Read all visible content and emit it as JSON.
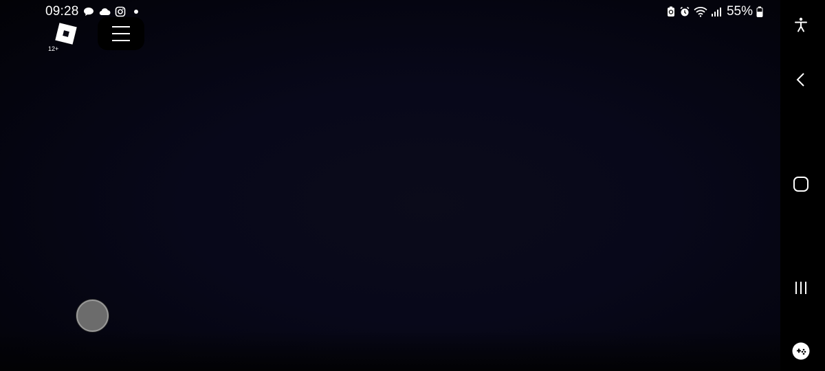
{
  "status_bar": {
    "time": "09:28",
    "battery_percent": "55%",
    "left_icons": [
      "chat-bubble-icon",
      "cloud-icon",
      "instagram-icon",
      "notification-dot-icon"
    ],
    "right_icons": [
      "battery-saver-icon",
      "alarm-icon",
      "wifi-icon",
      "signal-icon",
      "battery-icon"
    ]
  },
  "game_overlay": {
    "logo_icon": "roblox-logo-icon",
    "age_rating": "12+",
    "menu_icon": "hamburger-menu-icon",
    "joystick_icon": "virtual-joystick"
  },
  "nav_bar": {
    "icons": [
      "accessibility-icon",
      "back-icon",
      "home-icon",
      "recent-apps-icon",
      "game-tools-icon"
    ]
  },
  "colors": {
    "game_background": "#08081a",
    "nav_background": "#000000",
    "joystick": "#6c6c6c"
  }
}
